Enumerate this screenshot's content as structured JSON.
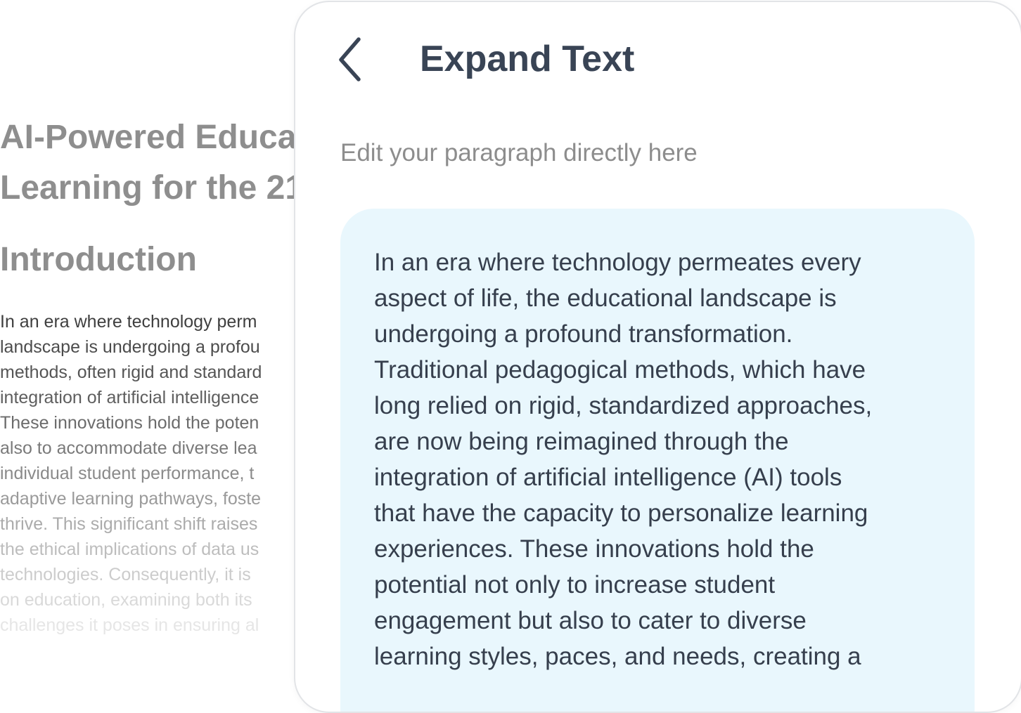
{
  "document": {
    "title_lines": [
      "AI-Powered Educa",
      "Learning for the 21"
    ],
    "heading": "Introduction",
    "body_lines": [
      {
        "text": "In an era where technology perm",
        "color": "#3f3f3f"
      },
      {
        "text": "landscape is undergoing a profou",
        "color": "#4c4c4c"
      },
      {
        "text": "methods, often rigid and standard",
        "color": "#555555"
      },
      {
        "text": "integration of artificial intelligence",
        "color": "#5e5e5e"
      },
      {
        "text": "These innovations hold the poten",
        "color": "#6b6b6b"
      },
      {
        "text": "also to accommodate diverse lea",
        "color": "#7a7a7a"
      },
      {
        "text": "individual student performance, t",
        "color": "#8a8a8a"
      },
      {
        "text": "adaptive learning pathways, foste",
        "color": "#9a9a9a"
      },
      {
        "text": "thrive. This significant shift raises",
        "color": "#ababab"
      },
      {
        "text": "the ethical implications of data us",
        "color": "#bdbdbd"
      },
      {
        "text": "technologies. Consequently, it is",
        "color": "#cccccc"
      },
      {
        "text": "on education, examining both its",
        "color": "#d9d9d9"
      },
      {
        "text": "challenges it poses in ensuring al",
        "color": "#e6e6e6"
      }
    ]
  },
  "panel": {
    "title": "Expand Text",
    "back_icon": "chevron-left-icon",
    "hint": "Edit your paragraph directly here",
    "editor_lines": [
      "In an era where technology permeates every",
      "aspect of life, the educational landscape is",
      "undergoing a profound transformation.",
      "Traditional pedagogical methods, which have",
      "long relied on rigid, standardized approaches,",
      "are now being reimagined through the",
      "integration of artificial intelligence (AI) tools",
      "that have the capacity to personalize learning",
      "experiences. These innovations hold the",
      "potential not only to increase student",
      "engagement but also to cater to diverse",
      "learning styles, paces, and needs, creating a"
    ]
  },
  "colors": {
    "title": "#394455",
    "editor_background": "#e9f7fd",
    "editor_text": "#363f4d",
    "hint": "#8d8d8d",
    "panel_border": "#e2e4e7"
  }
}
